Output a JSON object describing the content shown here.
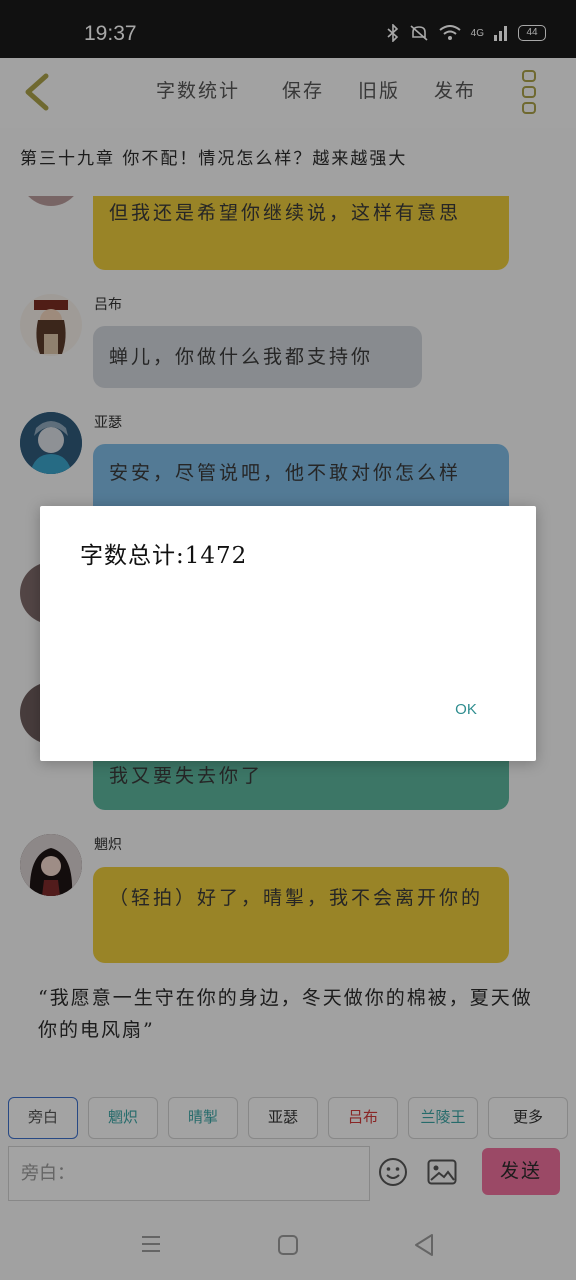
{
  "status": {
    "time": "19:37",
    "network": "4G",
    "battery": "44"
  },
  "toolbar": {
    "word_count": "字数统计",
    "save": "保存",
    "old_version": "旧版",
    "publish": "发布"
  },
  "chapter_title": "第三十九章  你不配！情况怎么样？越来越强大",
  "messages": [
    {
      "text": "但我还是希望你继续说，这样有意思",
      "color": "#e9c83c"
    },
    {
      "speaker": "吕布",
      "text": "蝉儿，你做什么我都支持你",
      "color": "#cfd3d9"
    },
    {
      "speaker": "亚瑟",
      "text": "安安，尽管说吧，他不敢对你怎么样",
      "color": "#7fb9e3"
    },
    {
      "text": "我又要失去你了",
      "color": "#5bb39c"
    },
    {
      "speaker": "魍炽",
      "text": "（轻拍）好了，晴掣，我不会离开你的",
      "color": "#e9c83c"
    }
  ],
  "narration": "“我愿意一生守在你的身边，冬天做你的棉被，夏天做你的电风扇”",
  "roles": [
    {
      "label": "旁白",
      "color": "#555555"
    },
    {
      "label": "魍炽",
      "color": "#3aa3a3"
    },
    {
      "label": "晴掣",
      "color": "#3aa3a3"
    },
    {
      "label": "亚瑟",
      "color": "#333333"
    },
    {
      "label": "吕布",
      "color": "#d13a3a"
    },
    {
      "label": "兰陵王",
      "color": "#3aa3a3"
    },
    {
      "label": "更多",
      "color": "#333333"
    }
  ],
  "input": {
    "placeholder": "旁白："
  },
  "send_label": "发送",
  "dialog": {
    "message": "字数总计:1472",
    "ok_label": "OK"
  }
}
